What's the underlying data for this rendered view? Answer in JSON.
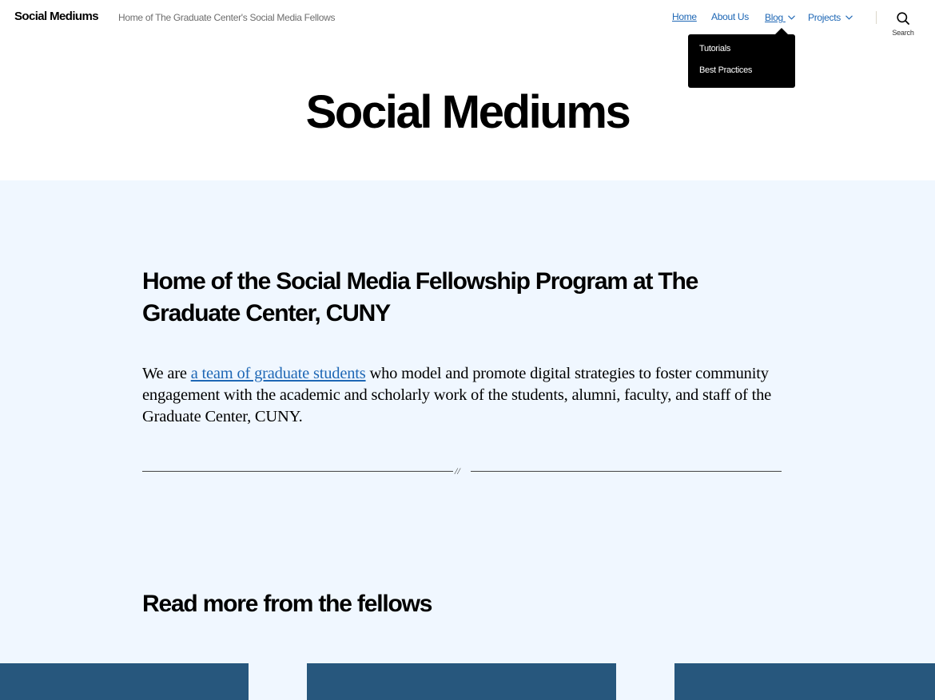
{
  "header": {
    "site_title": "Social Mediums",
    "tagline": "Home of The Graduate Center's Social Media Fellows",
    "nav": {
      "home": "Home",
      "about": "About Us",
      "blog": "Blog",
      "projects": "Projects"
    },
    "blog_submenu": [
      "Tutorials",
      "Best Practices"
    ],
    "search_label": "Search"
  },
  "hero": {
    "title": "Social Mediums"
  },
  "intro": {
    "heading": "Home of the Social Media Fellowship Program at The Graduate Center, CUNY",
    "para_start": "We are ",
    "para_link": "a team of graduate students",
    "para_end": " who model and promote digital strategies to foster community engagement with the academic and scholarly work of the students, alumni, faculty, and staff of the Graduate Center, CUNY.",
    "separator_mark": "//"
  },
  "more": {
    "heading": "Read more from the fellows"
  },
  "colors": {
    "accent_link": "#1e67b5",
    "band_background": "#f0f7ff",
    "card_background": "#27577d",
    "submenu_background": "#000000"
  },
  "icons": {
    "search": "search-icon",
    "chevron": "chevron-down-icon"
  }
}
